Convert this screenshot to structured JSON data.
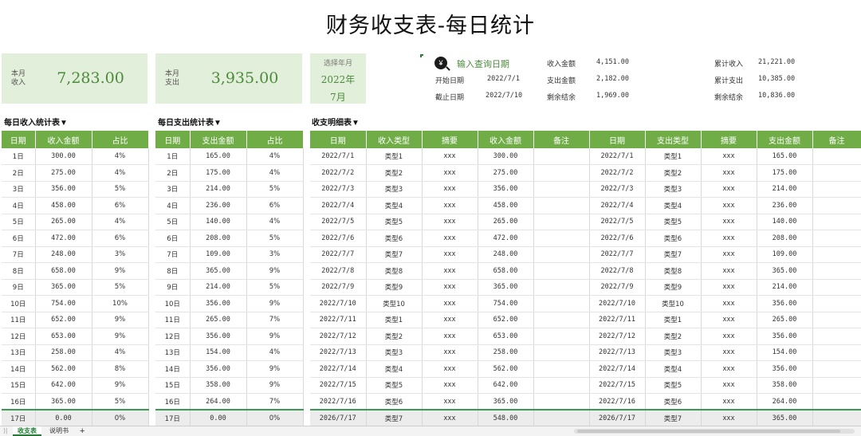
{
  "title": "财务收支表-每日统计",
  "cards": {
    "income": {
      "label": "本月收入",
      "value": "7,283.00"
    },
    "expense": {
      "label": "本月支出",
      "value": "3,935.00"
    },
    "year": {
      "label": "选择年月",
      "year": "2022年",
      "month": "7月"
    }
  },
  "query": {
    "icon": "yen-search-icon",
    "title": "输入查询日期",
    "start_label": "开始日期",
    "start_value": "2022/7/1",
    "end_label": "截止日期",
    "end_value": "2022/7/10",
    "income_label": "收入金额",
    "income_value": "4,151.00",
    "expense_label": "支出金额",
    "expense_value": "2,182.00",
    "balance_label": "剩余结余",
    "balance_value": "1,969.00",
    "cum_income_label": "累计收入",
    "cum_income_value": "21,221.00",
    "cum_expense_label": "累计支出",
    "cum_expense_value": "10,385.00",
    "cum_balance_label": "剩余结余",
    "cum_balance_value": "10,836.00"
  },
  "income_table": {
    "title": "每日收入统计表▼",
    "headers": [
      "日期",
      "收入金额",
      "占比"
    ],
    "rows": [
      [
        "1日",
        "300.00",
        "4%"
      ],
      [
        "2日",
        "275.00",
        "4%"
      ],
      [
        "3日",
        "356.00",
        "5%"
      ],
      [
        "4日",
        "458.00",
        "6%"
      ],
      [
        "5日",
        "265.00",
        "4%"
      ],
      [
        "6日",
        "472.00",
        "6%"
      ],
      [
        "7日",
        "248.00",
        "3%"
      ],
      [
        "8日",
        "658.00",
        "9%"
      ],
      [
        "9日",
        "365.00",
        "5%"
      ],
      [
        "10日",
        "754.00",
        "10%"
      ],
      [
        "11日",
        "652.00",
        "9%"
      ],
      [
        "12日",
        "653.00",
        "9%"
      ],
      [
        "13日",
        "258.00",
        "4%"
      ],
      [
        "14日",
        "562.00",
        "8%"
      ],
      [
        "15日",
        "642.00",
        "9%"
      ],
      [
        "16日",
        "365.00",
        "5%"
      ],
      [
        "17日",
        "0.00",
        "0%"
      ]
    ]
  },
  "expense_table": {
    "title": "每日支出统计表▼",
    "headers": [
      "日期",
      "支出金额",
      "占比"
    ],
    "rows": [
      [
        "1日",
        "165.00",
        "4%"
      ],
      [
        "2日",
        "175.00",
        "4%"
      ],
      [
        "3日",
        "214.00",
        "5%"
      ],
      [
        "4日",
        "236.00",
        "6%"
      ],
      [
        "5日",
        "140.00",
        "4%"
      ],
      [
        "6日",
        "208.00",
        "5%"
      ],
      [
        "7日",
        "109.00",
        "3%"
      ],
      [
        "8日",
        "365.00",
        "9%"
      ],
      [
        "9日",
        "214.00",
        "5%"
      ],
      [
        "10日",
        "356.00",
        "9%"
      ],
      [
        "11日",
        "265.00",
        "7%"
      ],
      [
        "12日",
        "356.00",
        "9%"
      ],
      [
        "13日",
        "154.00",
        "4%"
      ],
      [
        "14日",
        "356.00",
        "9%"
      ],
      [
        "15日",
        "358.00",
        "9%"
      ],
      [
        "16日",
        "264.00",
        "7%"
      ],
      [
        "17日",
        "0.00",
        "0%"
      ]
    ]
  },
  "detail_table": {
    "title": "收支明细表▼",
    "headers": [
      "日期",
      "收入类型",
      "摘要",
      "收入金额",
      "备注",
      "日期",
      "支出类型",
      "摘要",
      "支出金额",
      "备注"
    ],
    "rows": [
      [
        "2022/7/1",
        "类型1",
        "xxx",
        "300.00",
        "",
        "2022/7/1",
        "类型1",
        "xxx",
        "165.00",
        ""
      ],
      [
        "2022/7/2",
        "类型2",
        "xxx",
        "275.00",
        "",
        "2022/7/2",
        "类型2",
        "xxx",
        "175.00",
        ""
      ],
      [
        "2022/7/3",
        "类型3",
        "xxx",
        "356.00",
        "",
        "2022/7/3",
        "类型3",
        "xxx",
        "214.00",
        ""
      ],
      [
        "2022/7/4",
        "类型4",
        "xxx",
        "458.00",
        "",
        "2022/7/4",
        "类型4",
        "xxx",
        "236.00",
        ""
      ],
      [
        "2022/7/5",
        "类型5",
        "xxx",
        "265.00",
        "",
        "2022/7/5",
        "类型5",
        "xxx",
        "140.00",
        ""
      ],
      [
        "2022/7/6",
        "类型6",
        "xxx",
        "472.00",
        "",
        "2022/7/6",
        "类型6",
        "xxx",
        "208.00",
        ""
      ],
      [
        "2022/7/7",
        "类型7",
        "xxx",
        "248.00",
        "",
        "2022/7/7",
        "类型7",
        "xxx",
        "109.00",
        ""
      ],
      [
        "2022/7/8",
        "类型8",
        "xxx",
        "658.00",
        "",
        "2022/7/8",
        "类型8",
        "xxx",
        "365.00",
        ""
      ],
      [
        "2022/7/9",
        "类型9",
        "xxx",
        "365.00",
        "",
        "2022/7/9",
        "类型9",
        "xxx",
        "214.00",
        ""
      ],
      [
        "2022/7/10",
        "类型10",
        "xxx",
        "754.00",
        "",
        "2022/7/10",
        "类型10",
        "xxx",
        "356.00",
        ""
      ],
      [
        "2022/7/11",
        "类型1",
        "xxx",
        "652.00",
        "",
        "2022/7/11",
        "类型1",
        "xxx",
        "265.00",
        ""
      ],
      [
        "2022/7/12",
        "类型2",
        "xxx",
        "653.00",
        "",
        "2022/7/12",
        "类型2",
        "xxx",
        "356.00",
        ""
      ],
      [
        "2022/7/13",
        "类型3",
        "xxx",
        "258.00",
        "",
        "2022/7/13",
        "类型3",
        "xxx",
        "154.00",
        ""
      ],
      [
        "2022/7/14",
        "类型4",
        "xxx",
        "562.00",
        "",
        "2022/7/14",
        "类型4",
        "xxx",
        "356.00",
        ""
      ],
      [
        "2022/7/15",
        "类型5",
        "xxx",
        "642.00",
        "",
        "2022/7/15",
        "类型5",
        "xxx",
        "358.00",
        ""
      ],
      [
        "2022/7/16",
        "类型6",
        "xxx",
        "365.00",
        "",
        "2022/7/16",
        "类型6",
        "xxx",
        "264.00",
        ""
      ],
      [
        "2026/7/17",
        "类型7",
        "xxx",
        "548.00",
        "",
        "2026/7/17",
        "类型7",
        "xxx",
        "365.00",
        ""
      ]
    ]
  },
  "sheets": {
    "tabs": [
      "收支表",
      "说明书"
    ],
    "active": 0,
    "add": "+"
  },
  "colors": {
    "header_green": "#70ad47",
    "card_bg": "#e2efda",
    "value_green": "#4c8a3c"
  }
}
